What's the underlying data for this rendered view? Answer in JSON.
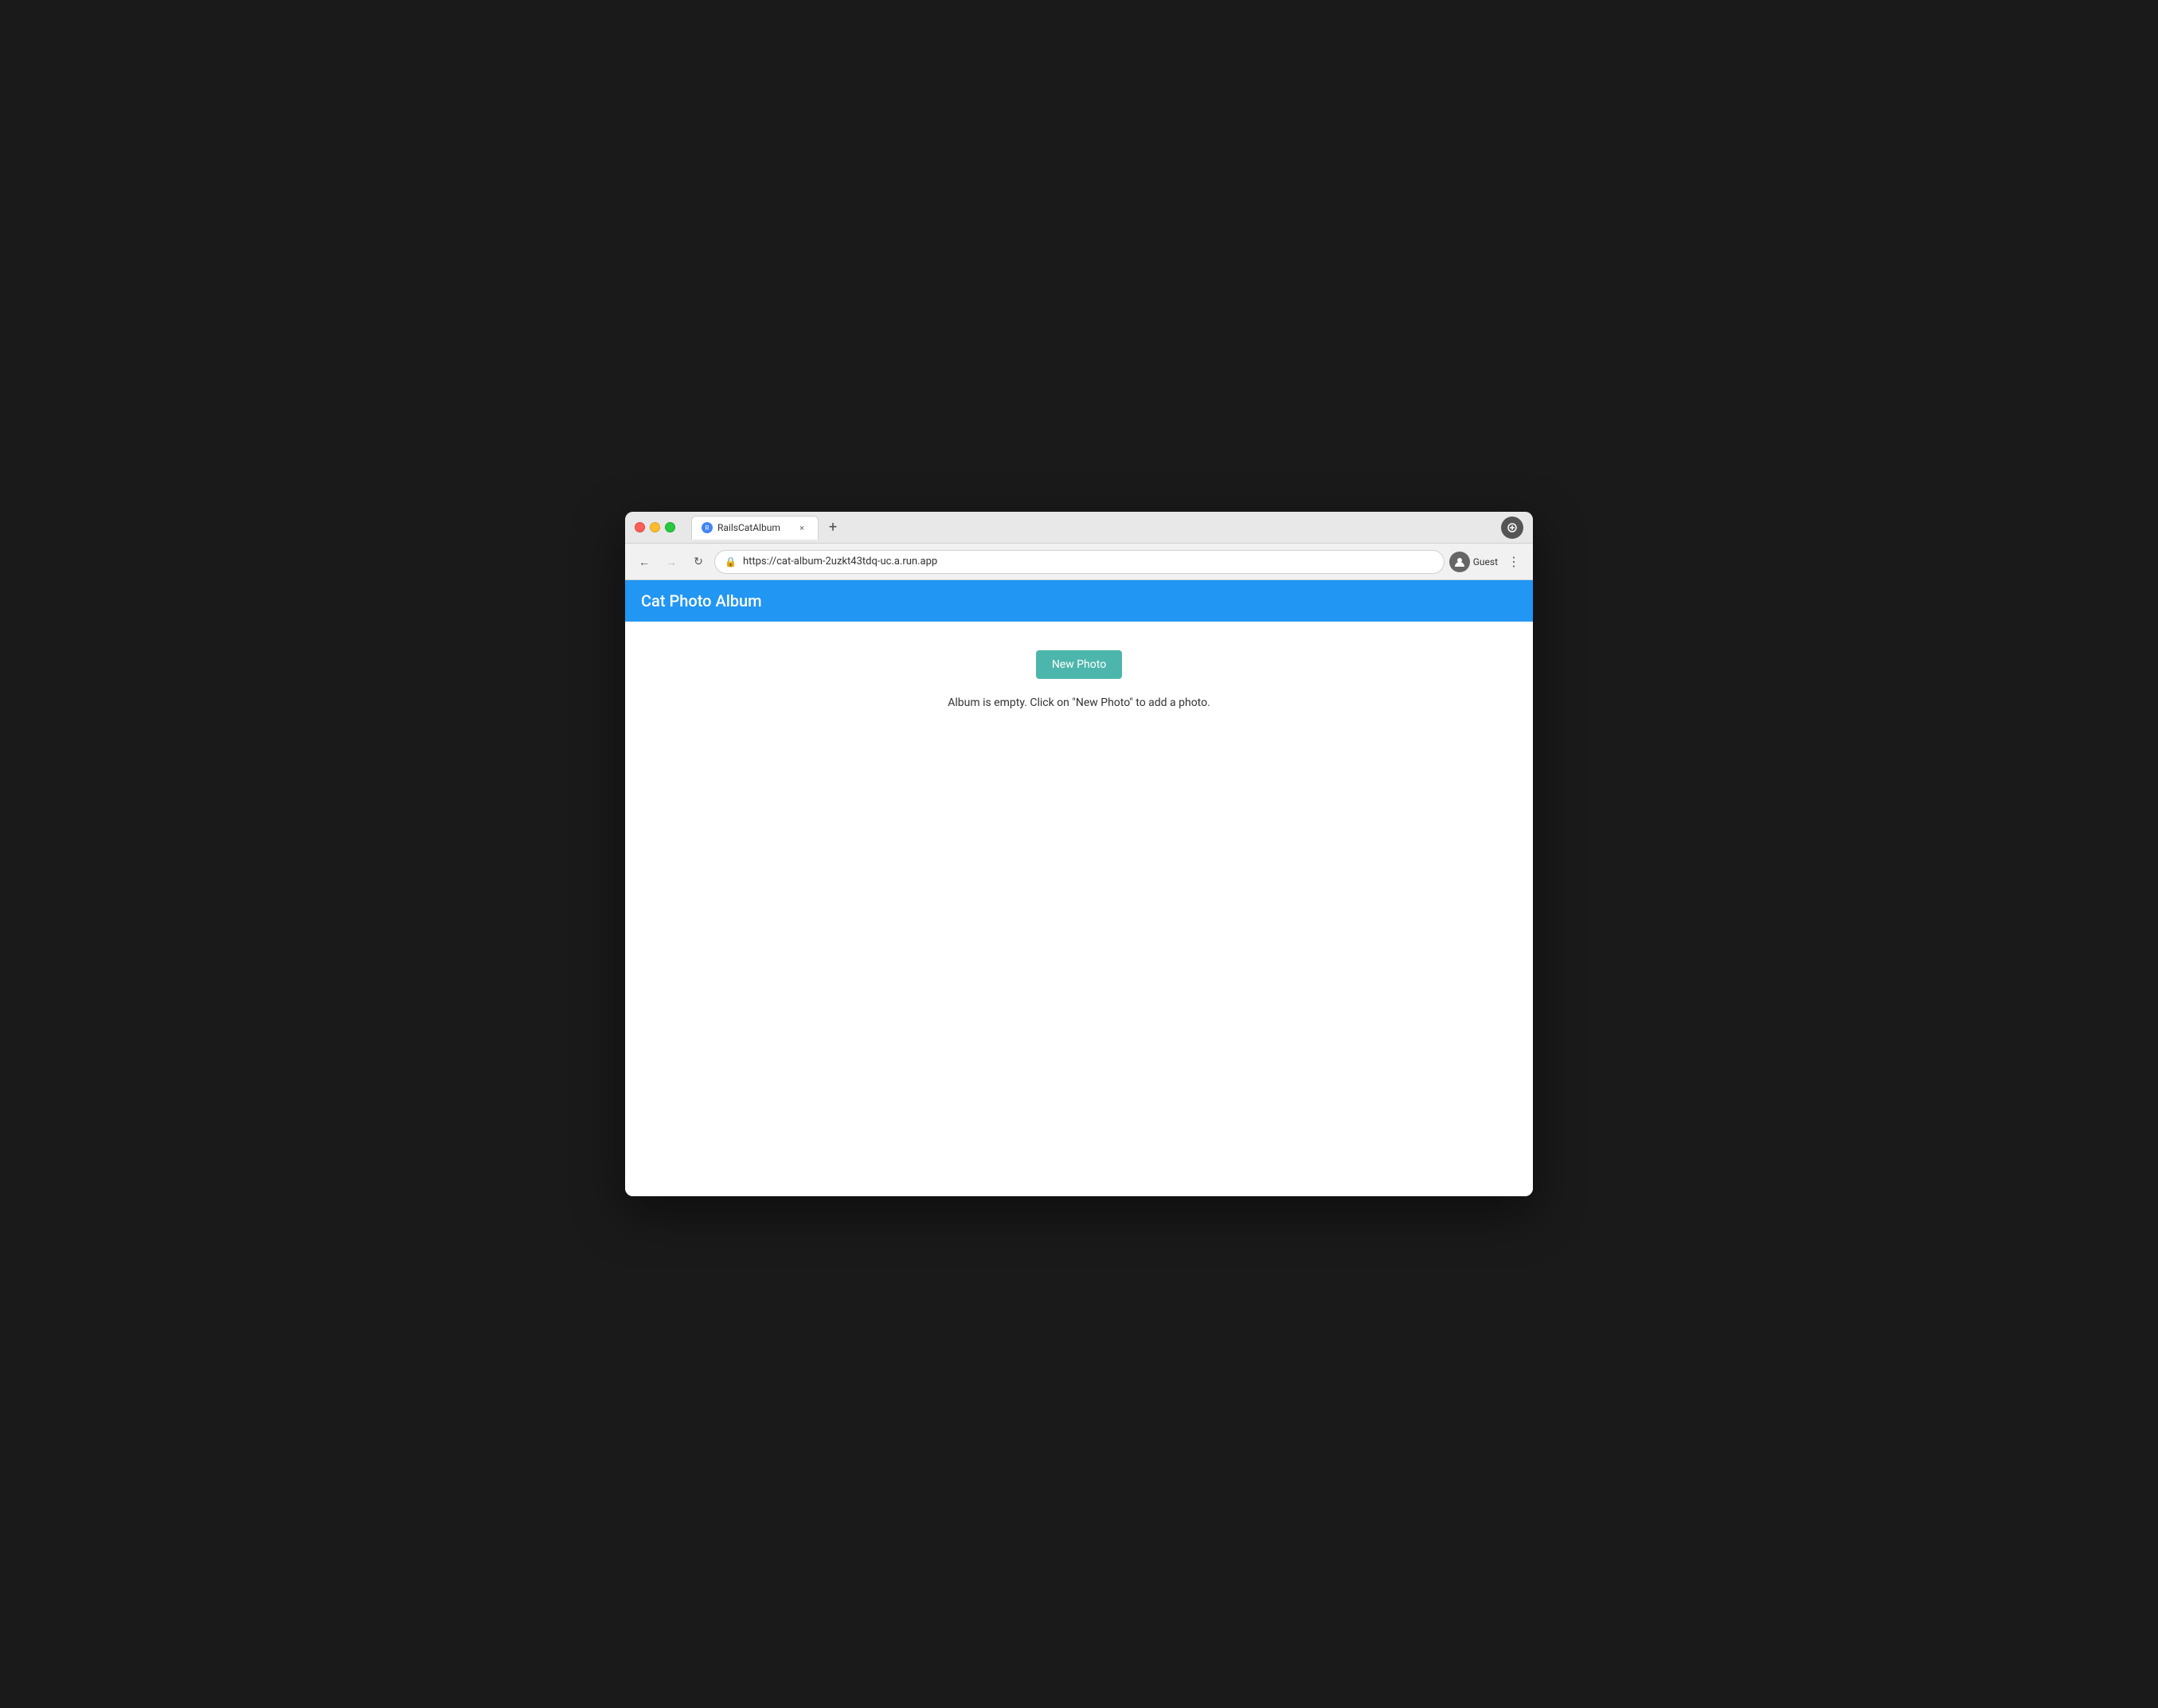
{
  "browser": {
    "tab": {
      "favicon_label": "R",
      "title": "RailsCatAlbum",
      "close_label": "×"
    },
    "new_tab_label": "+",
    "controls_right": {
      "circle_label": "●"
    },
    "nav": {
      "back_label": "←",
      "forward_label": "→",
      "reload_label": "↻",
      "address": "https://cat-album-2uzkt43tdq-uc.a.run.app",
      "lock_icon": "🔒",
      "profile_icon": "👤",
      "profile_label": "Guest",
      "more_label": "⋮"
    }
  },
  "app": {
    "header": {
      "title": "Cat Photo Album"
    },
    "body": {
      "new_photo_btn": "New Photo",
      "empty_message": "Album is empty. Click on \"New Photo\" to add a photo."
    }
  }
}
